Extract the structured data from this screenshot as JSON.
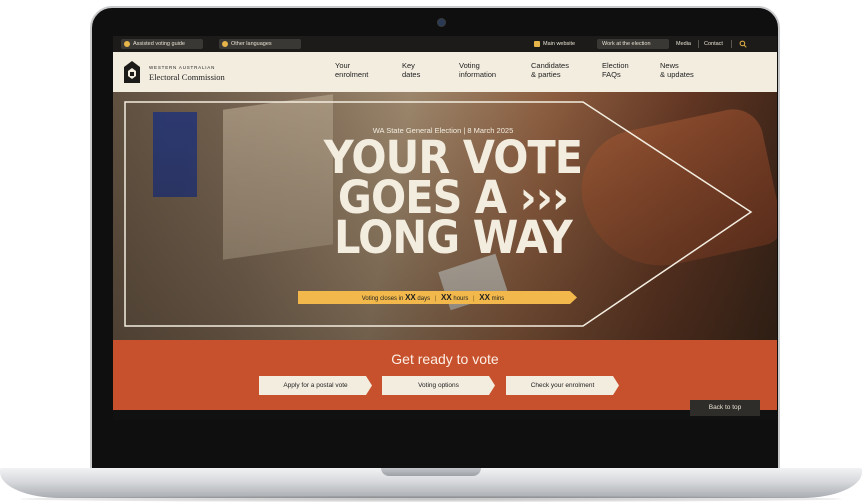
{
  "utility_bar": {
    "assisted_voting": "Assisted voting guide",
    "other_languages": "Other languages",
    "main_website": "Main website",
    "work_at_election": "Work at the election",
    "media": "Media",
    "contact": "Contact",
    "search_icon": "search-icon"
  },
  "header": {
    "logo_small": "WESTERN AUSTRALIAN",
    "logo_big": "Electoral Commission",
    "nav": [
      {
        "label": "Your\nenrolment"
      },
      {
        "label": "Key\ndates"
      },
      {
        "label": "Voting\ninformation"
      },
      {
        "label": "Candidates\n& parties"
      },
      {
        "label": "Election\nFAQs"
      },
      {
        "label": "News\n& updates"
      }
    ]
  },
  "hero": {
    "subtitle": "WA State General Election  |  8 March 2025",
    "headline_line1": "YOUR VOTE",
    "headline_line2": "GOES A ›››",
    "headline_line3": "LONG WAY",
    "countdown": {
      "prefix": "Voting closes in",
      "days_value": "XX",
      "days_unit": "days",
      "hours_value": "XX",
      "hours_unit": "hours",
      "mins_value": "XX",
      "mins_unit": "mins"
    }
  },
  "band": {
    "title": "Get ready to vote",
    "buttons": [
      {
        "label": "Apply for a postal vote"
      },
      {
        "label": "Voting options"
      },
      {
        "label": "Check your enrolment"
      }
    ]
  },
  "back_to_top": "Back to top",
  "colors": {
    "accent_orange": "#c8512d",
    "countdown_yellow": "#f2b84b",
    "header_cream": "#f3ede0",
    "utility_dark": "#1c1b19"
  }
}
